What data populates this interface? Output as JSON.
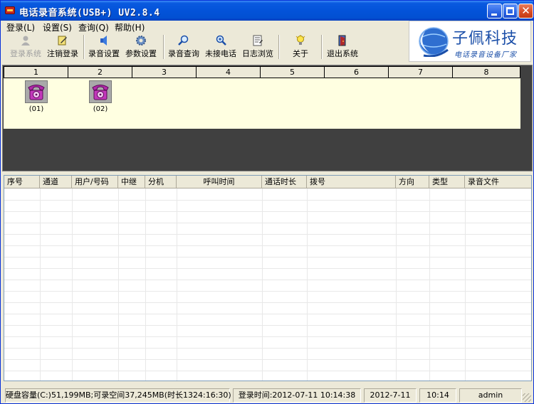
{
  "window": {
    "title": "电话录音系统(USB+) UV2.8.4"
  },
  "menu": [
    {
      "label": "登录(L)"
    },
    {
      "label": "设置(S)"
    },
    {
      "label": "查询(Q)"
    },
    {
      "label": "帮助(H)"
    }
  ],
  "toolbar": {
    "login": {
      "label": "登录系统",
      "enabled": false,
      "icon": "user-login-icon"
    },
    "logout": {
      "label": "注销登录",
      "icon": "logout-icon"
    },
    "record_settings": {
      "label": "录音设置",
      "icon": "speaker-icon"
    },
    "param_settings": {
      "label": "参数设置",
      "icon": "gear-icon"
    },
    "record_query": {
      "label": "录音查询",
      "icon": "magnifier-icon"
    },
    "missed_calls": {
      "label": "未接电话",
      "icon": "magnifier-plus-icon"
    },
    "log_browse": {
      "label": "日志浏览",
      "icon": "log-icon"
    },
    "about": {
      "label": "关于",
      "icon": "lightbulb-icon"
    },
    "exit": {
      "label": "退出系统",
      "icon": "exit-door-icon"
    }
  },
  "logo": {
    "name": "子佩科技",
    "slogan": "电话录音设备厂家"
  },
  "channels": {
    "headers": [
      "1",
      "2",
      "3",
      "4",
      "5",
      "6",
      "7",
      "8"
    ],
    "phones": [
      {
        "label": "(01)",
        "color": "#b02aa8"
      },
      {
        "label": "(02)",
        "color": "#b02aa8"
      }
    ]
  },
  "call_list": {
    "columns": [
      "序号",
      "通道",
      "用户/号码",
      "中继",
      "分机",
      "呼叫时间",
      "通话时长",
      "拨号",
      "方向",
      "类型",
      "录音文件"
    ],
    "rows": []
  },
  "status": {
    "disk": "硬盘容量(C:)51,199MB;可录空间37,245MB(时长1324:16:30)",
    "login_time": "登录时间:2012-07-11 10:14:38",
    "date": "2012-7-11",
    "time": "10:14",
    "user": "admin"
  }
}
